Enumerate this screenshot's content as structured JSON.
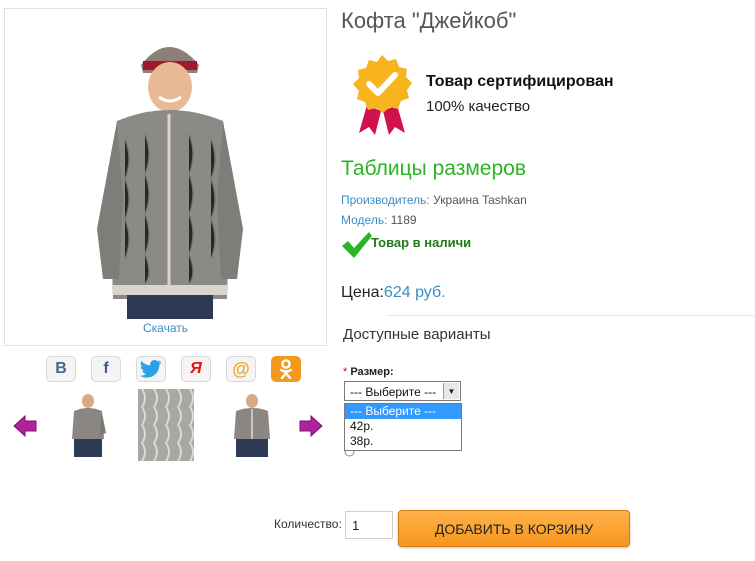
{
  "product": {
    "title": "Кофта \"Джейкоб\"",
    "download_label": "Скачать"
  },
  "social": [
    {
      "name": "vkontakte-icon",
      "glyph": "В",
      "color": "#45668e"
    },
    {
      "name": "facebook-icon",
      "glyph": "f",
      "color": "#3b5998"
    },
    {
      "name": "twitter-icon",
      "glyph": "🐦",
      "color": "#1da1f2"
    },
    {
      "name": "yandex-icon",
      "glyph": "Я",
      "color": "#e61400"
    },
    {
      "name": "mailru-icon",
      "glyph": "@",
      "color": "#f5a623"
    },
    {
      "name": "odnoklassniki-icon",
      "glyph": "ок",
      "color": "#ed812b"
    }
  ],
  "certificate": {
    "title": "Товар сертифицирован",
    "subtitle": "100% качество"
  },
  "sizes_link": "Таблицы размеров",
  "manufacturer": {
    "label": "Производитель:",
    "value": "Украина Tashkan"
  },
  "model": {
    "label": "Модель:",
    "value": "1189"
  },
  "stock_status": "Товар в наличи",
  "price": {
    "label": "Цена:",
    "value": "624 руб."
  },
  "variants_heading": "Доступные варианты",
  "size_field": {
    "required_mark": "*",
    "label": "Размер:",
    "selected": "--- Выберите ---",
    "options": [
      "--- Выберите ---",
      "42р.",
      "38р."
    ]
  },
  "quantity": {
    "label": "Количество:",
    "value": "1"
  },
  "add_to_cart_label": "ДОБАВИТЬ В КОРЗИНУ",
  "colors": {
    "accent": "#3a8dc4",
    "green": "#2db323",
    "cart": "#f5961e"
  }
}
